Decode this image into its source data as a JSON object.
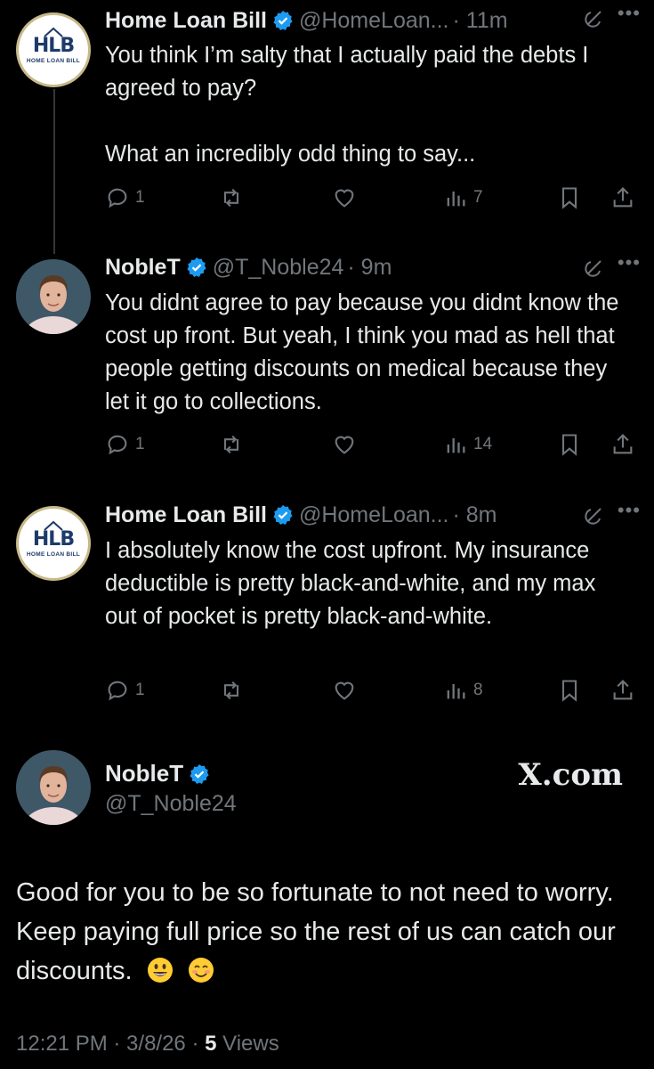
{
  "tweets": [
    {
      "name": "Home Loan Bill",
      "handle": "@HomeLoan...",
      "time": "· 11m",
      "avatar": "HLB",
      "avatar_brand": "HOME LOAN BILL",
      "text": "You think I’m salty that I actually paid the debts I agreed to pay?\n\nWhat an incredibly odd thing to say...",
      "replies": "1",
      "views": "7"
    },
    {
      "name": "NobleT",
      "handle": "@T_Noble24",
      "time": "· 9m",
      "avatar": "person",
      "text": "You didnt agree to pay because you didnt know the cost up front. But yeah, I think you mad as hell that people getting discounts on medical because they let it go to collections.",
      "replies": "1",
      "views": "14"
    },
    {
      "name": "Home Loan Bill",
      "handle": "@HomeLoan...",
      "time": "· 8m",
      "avatar": "HLB",
      "avatar_brand": "HOME LOAN BILL",
      "text": "I absolutely know the cost upfront. My insurance deductible is pretty black-and-white, and my max out of pocket is pretty black-and-white.",
      "replies": "1",
      "views": "8"
    }
  ],
  "main": {
    "name": "NobleT",
    "handle": "@T_Noble24",
    "watermark": "X.com",
    "text": "Good for you to be so fortunate to not need to worry. Keep paying full price so the rest of us can catch our discounts.",
    "time": "12:21 PM · 3/8/26 · ",
    "views_count": "5",
    "views_label": " Views"
  },
  "colors": {
    "background": "#000000",
    "text": "#e7e9ea",
    "muted": "#71767b",
    "verified": "#1d9bf0"
  },
  "icons": [
    "verified-badge-icon",
    "grok-icon",
    "more-icon",
    "reply-icon",
    "repost-icon",
    "like-icon",
    "views-icon",
    "bookmark-icon",
    "share-icon",
    "grinning-emoji",
    "smiling-emoji"
  ]
}
